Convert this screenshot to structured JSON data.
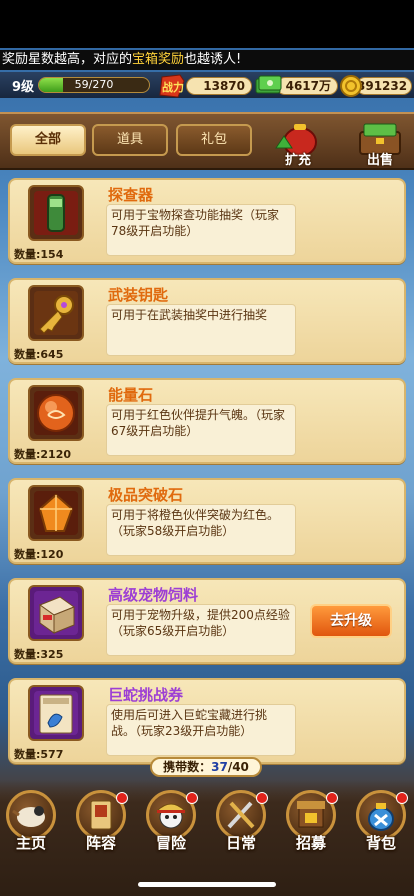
{
  "marquee": {
    "text_before": "奖励星数越高，对应的",
    "text_highlight": "宝箱奖励",
    "text_after": "也越诱人!"
  },
  "status": {
    "level": "9级",
    "exp": "59/270",
    "exp_fraction": 0.22,
    "power_label": "战力",
    "power": "13870",
    "cash": "4617万",
    "gold": "391232"
  },
  "tabs": [
    {
      "label": "全部",
      "active": true
    },
    {
      "label": "道具",
      "active": false
    },
    {
      "label": "礼包",
      "active": false
    }
  ],
  "side_buttons": {
    "expand": "扩充",
    "sell": "出售"
  },
  "items": [
    {
      "name": "探查器",
      "desc": "可用于宝物探查功能抽奖（玩家78级开启功能）",
      "qty": "数量:154",
      "icon": "detector-icon",
      "name_color": "orange"
    },
    {
      "name": "武装钥匙",
      "desc": "可用于在武装抽奖中进行抽奖",
      "qty": "数量:645",
      "icon": "key-icon",
      "name_color": "orange"
    },
    {
      "name": "能量石",
      "desc": "可用于红色伙伴提升气魄。（玩家67级开启功能）",
      "qty": "数量:2120",
      "icon": "energy-stone-icon",
      "name_color": "orange"
    },
    {
      "name": "极品突破石",
      "desc": "可用于将橙色伙伴突破为红色。（玩家58级开启功能）",
      "qty": "数量:120",
      "icon": "breakthrough-stone-icon",
      "name_color": "orange"
    },
    {
      "name": "高级宠物饲料",
      "desc": "可用于宠物升级，提供200点经验（玩家65级开启功能）",
      "qty": "数量:325",
      "icon": "pet-food-icon",
      "name_color": "purple",
      "action": "去升级"
    },
    {
      "name": "巨蛇挑战券",
      "desc": "使用后可进入巨蛇宝藏进行挑战。（玩家23级开启功能）",
      "qty": "数量:577",
      "icon": "battle-ticket-icon",
      "name_color": "purple"
    }
  ],
  "carry": {
    "label": "携带数：",
    "current": "37",
    "max": "/40"
  },
  "nav": [
    {
      "label": "主页",
      "icon": "home-icon"
    },
    {
      "label": "阵容",
      "icon": "lineup-icon"
    },
    {
      "label": "冒险",
      "icon": "adventure-icon"
    },
    {
      "label": "日常",
      "icon": "daily-icon"
    },
    {
      "label": "招募",
      "icon": "recruit-icon"
    },
    {
      "label": "背包",
      "icon": "backpack-icon"
    }
  ]
}
